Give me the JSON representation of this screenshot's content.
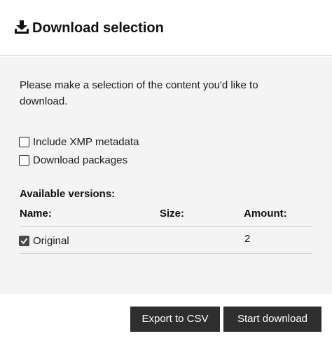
{
  "dialog": {
    "title": "Download selection",
    "icon": "download-icon"
  },
  "intro_text": "Please make a selection of the content you'd like to download.",
  "options": [
    {
      "label": "Include XMP metadata",
      "checked": false
    },
    {
      "label": "Download packages",
      "checked": false
    }
  ],
  "versions": {
    "title": "Available versions:",
    "columns": {
      "name": "Name:",
      "size": "Size:",
      "amount": "Amount:"
    },
    "rows": [
      {
        "name": "Original",
        "size": "",
        "amount": "2",
        "checked": true
      }
    ]
  },
  "buttons": {
    "export": "Export to CSV",
    "start": "Start download"
  },
  "colors": {
    "header_bg": "#ffffff",
    "body_bg": "#f4f4f4",
    "button_bg": "#2e2e2e",
    "button_text": "#ffffff"
  }
}
